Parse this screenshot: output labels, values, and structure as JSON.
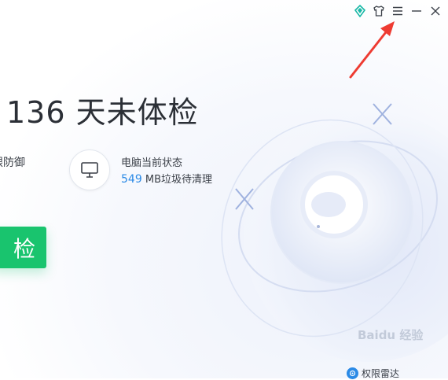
{
  "headline": {
    "days": "136",
    "suffix": "天未体检"
  },
  "protection": {
    "label": "跟防御"
  },
  "pc_status": {
    "title": "电脑当前状态",
    "junk_value": "549",
    "junk_text": "MB垃圾待清理"
  },
  "actions": {
    "check_label": "检"
  },
  "footer": {
    "permission_radar": "权限雷达"
  },
  "watermark": {
    "text": "Baidu 经验"
  },
  "colors": {
    "accent_green": "#19c46e",
    "accent_blue": "#2b8ae6",
    "annotation_red": "#ee3b32"
  },
  "icons": {
    "top_controls": [
      "diamond-icon",
      "shirt-icon",
      "menu-icon",
      "minimize-icon",
      "close-icon"
    ],
    "status": "monitor-icon"
  }
}
